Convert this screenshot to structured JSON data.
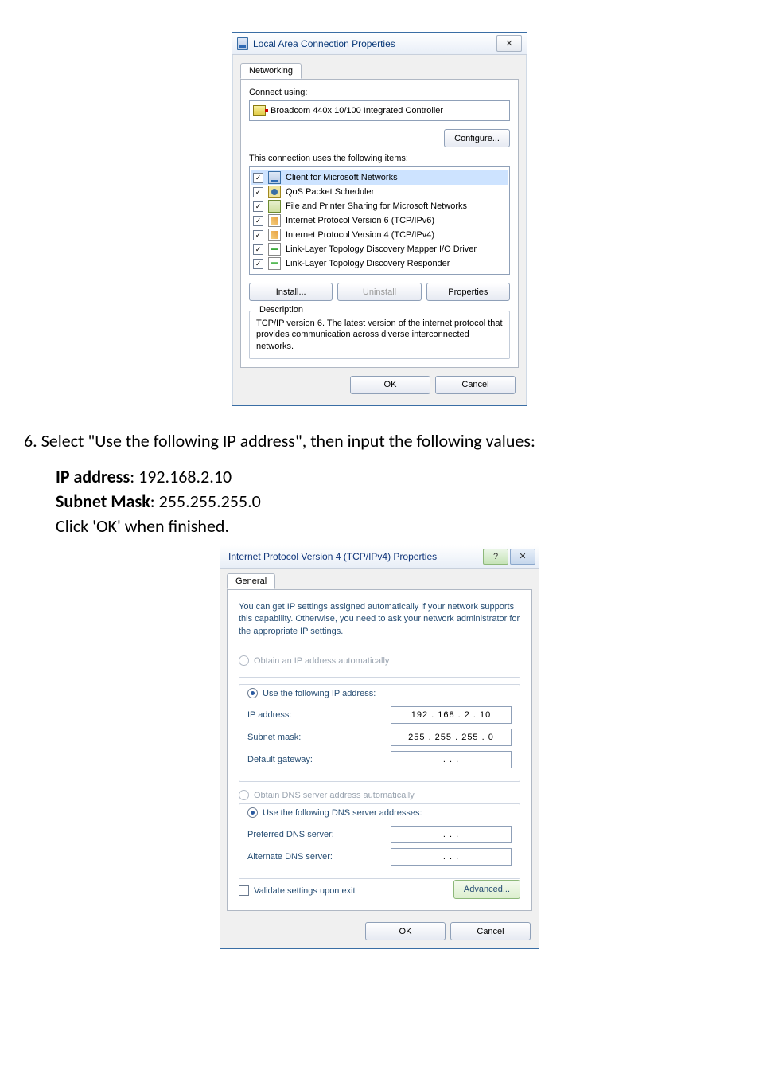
{
  "dialog1": {
    "title": "Local Area Connection Properties",
    "close_glyph": "✕",
    "tab_networking": "Networking",
    "connect_using_label": "Connect using:",
    "adapter_name": "Broadcom 440x 10/100 Integrated Controller",
    "configure_btn": "Configure...",
    "items_label": "This connection uses the following items:",
    "items": [
      {
        "label": "Client for Microsoft Networks",
        "selected": true,
        "icon": "ic-pc"
      },
      {
        "label": "QoS Packet Scheduler",
        "selected": false,
        "icon": "ic-qs"
      },
      {
        "label": "File and Printer Sharing for Microsoft Networks",
        "selected": false,
        "icon": "ic-fp"
      },
      {
        "label": "Internet Protocol Version 6 (TCP/IPv6)",
        "selected": false,
        "icon": "ic-ip"
      },
      {
        "label": "Internet Protocol Version 4 (TCP/IPv4)",
        "selected": false,
        "icon": "ic-ip"
      },
      {
        "label": "Link-Layer Topology Discovery Mapper I/O Driver",
        "selected": false,
        "icon": "ic-ll"
      },
      {
        "label": "Link-Layer Topology Discovery Responder",
        "selected": false,
        "icon": "ic-ll"
      }
    ],
    "install_btn": "Install...",
    "uninstall_btn": "Uninstall",
    "properties_btn": "Properties",
    "group_title": "Description",
    "description": "TCP/IP version 6. The latest version of the internet protocol that provides communication across diverse interconnected networks.",
    "ok_btn": "OK",
    "cancel_btn": "Cancel"
  },
  "body": {
    "step_no": "6.",
    "step_text": "Select \"Use the following IP address\", then input the following values:",
    "ip_label": "IP address",
    "ip_value": ": 192.168.2.10",
    "subnet_label": "Subnet Mask",
    "subnet_value": ": 255.255.255.0",
    "after": "Click 'OK' when finished."
  },
  "dialog2": {
    "title": "Internet Protocol Version 4 (TCP/IPv4) Properties",
    "help_glyph": "?",
    "close_glyph": "✕",
    "tab_general": "General",
    "intro": "You can get IP settings assigned automatically if your network supports this capability. Otherwise, you need to ask your network administrator for the appropriate IP settings.",
    "radio_auto_ip": "Obtain an IP address automatically",
    "radio_manual_ip": "Use the following IP address:",
    "ip_label": "IP address:",
    "ip_value": "192 . 168 .  2  . 10",
    "subnet_label": "Subnet mask:",
    "subnet_value": "255 . 255 . 255 .  0",
    "gateway_label": "Default gateway:",
    "gateway_value": ".        .        .",
    "radio_auto_dns": "Obtain DNS server address automatically",
    "radio_manual_dns": "Use the following DNS server addresses:",
    "pref_dns_label": "Preferred DNS server:",
    "pref_dns_value": ".        .        .",
    "alt_dns_label": "Alternate DNS server:",
    "alt_dns_value": ".        .        .",
    "validate_label": "Validate settings upon exit",
    "advanced_btn": "Advanced...",
    "ok_btn": "OK",
    "cancel_btn": "Cancel"
  }
}
